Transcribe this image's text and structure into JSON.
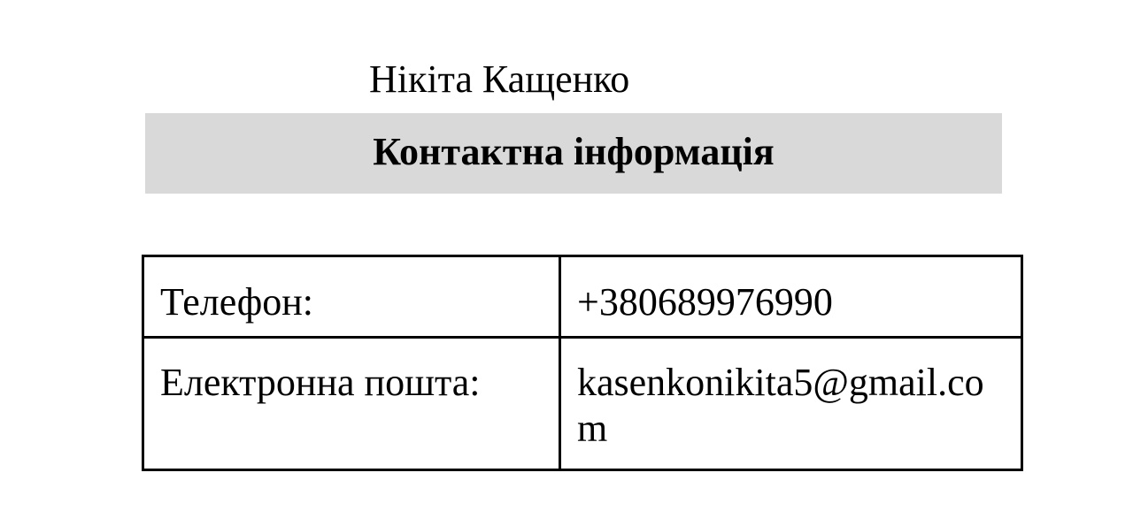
{
  "person": {
    "name": "Нікіта Кащенко"
  },
  "section": {
    "title": "Контактна інформація",
    "header_bg_color": "#d9d9d9"
  },
  "contacts": {
    "phone_label": "Телефон:",
    "phone_value": "+380689976990",
    "email_label": "Електронна пошта:",
    "email_value": "kasenkonikita5@gmail.com"
  }
}
